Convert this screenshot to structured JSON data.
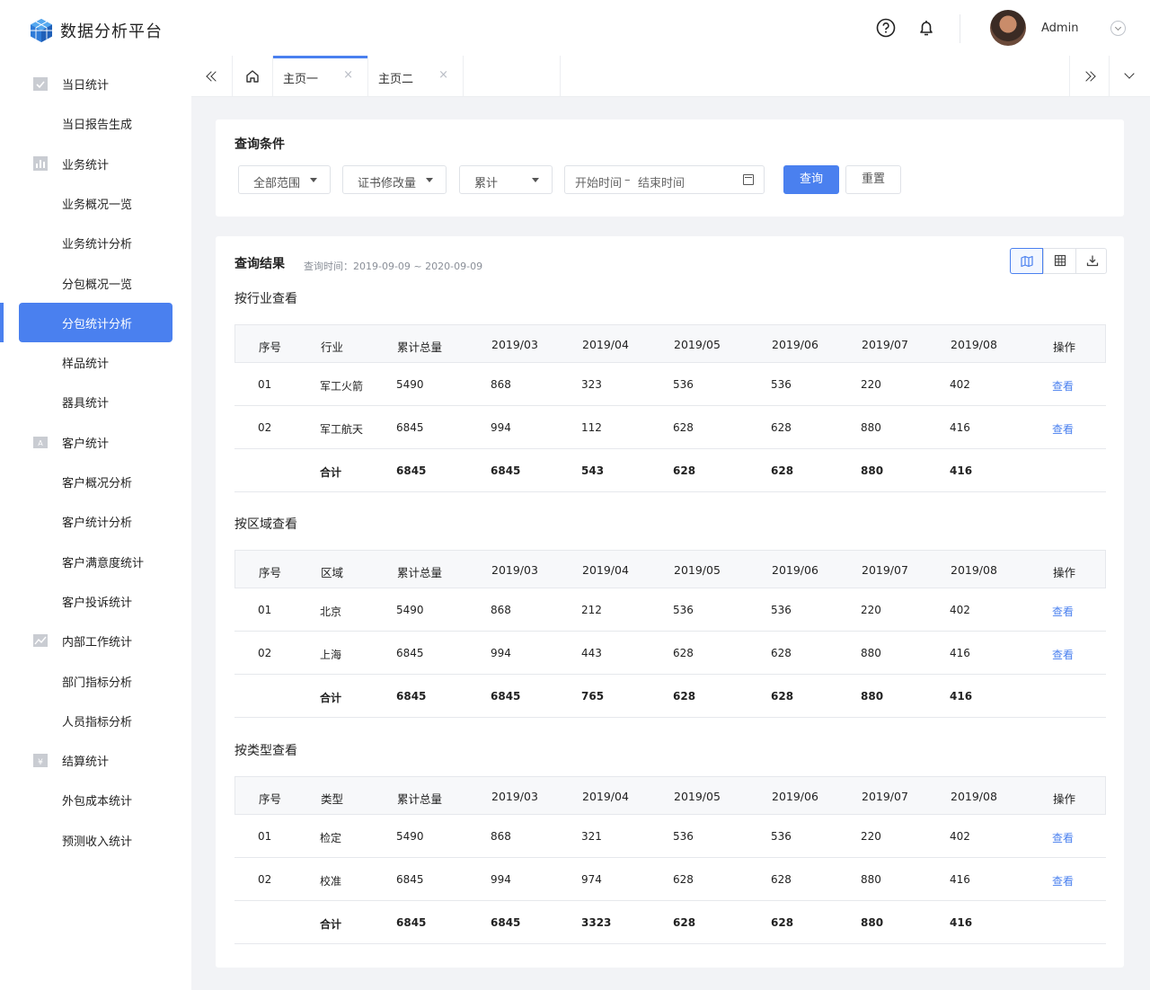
{
  "brand": "数据分析平台",
  "user": {
    "name": "Admin"
  },
  "colors": {
    "accent": "#4a80ef",
    "content_bg": "#f2f3f6"
  },
  "sidebar": {
    "items": [
      {
        "label": "当日统计",
        "icon": "calendar-check-icon",
        "level": 1
      },
      {
        "label": "当日报告生成",
        "level": 2
      },
      {
        "label": "业务统计",
        "icon": "bar-chart-icon",
        "level": 1
      },
      {
        "label": "业务概况一览",
        "level": 2
      },
      {
        "label": "业务统计分析",
        "level": 2
      },
      {
        "label": "分包概况一览",
        "level": 2
      },
      {
        "label": "分包统计分析",
        "level": 2,
        "active": true
      },
      {
        "label": "样品统计",
        "level": 2
      },
      {
        "label": "器具统计",
        "level": 2
      },
      {
        "label": "客户统计",
        "icon": "customer-card-icon",
        "level": 1
      },
      {
        "label": "客户概况分析",
        "level": 2
      },
      {
        "label": "客户统计分析",
        "level": 2
      },
      {
        "label": "客户满意度统计",
        "level": 2
      },
      {
        "label": "客户投诉统计",
        "level": 2
      },
      {
        "label": "内部工作统计",
        "icon": "trend-chart-icon",
        "level": 1
      },
      {
        "label": "部门指标分析",
        "level": 2
      },
      {
        "label": "人员指标分析",
        "level": 2
      },
      {
        "label": "结算统计",
        "icon": "yen-icon",
        "level": 1
      },
      {
        "label": "外包成本统计",
        "level": 2
      },
      {
        "label": "预测收入统计",
        "level": 2
      }
    ]
  },
  "tabs": [
    {
      "label": "主页一",
      "close": "×",
      "active": true
    },
    {
      "label": "主页二",
      "close": "×"
    }
  ],
  "query": {
    "title": "查询条件",
    "scope": "全部范围",
    "type": "证书修改量",
    "mode": "累计",
    "date_start": "开始时间",
    "date_sep": "–",
    "date_end": "结束时间",
    "search": "查询",
    "reset": "重置"
  },
  "results": {
    "title": "查询结果",
    "time": "查询时间：2019-09-09 ~ 2020-09-09",
    "headers_common": [
      "序号",
      "",
      "累计总量",
      "2019/03",
      "2019/04",
      "2019/05",
      "2019/06",
      "2019/07",
      "2019/08",
      "操作"
    ],
    "sections": [
      {
        "title": "按行业查看",
        "dim": "行业",
        "rows": [
          [
            "01",
            "军工火箭",
            "5490",
            "868",
            "323",
            "536",
            "536",
            "220",
            "402",
            "查看"
          ],
          [
            "02",
            "军工航天",
            "6845",
            "994",
            "112",
            "628",
            "628",
            "880",
            "416",
            "查看"
          ]
        ],
        "total": [
          "",
          "合计",
          "6845",
          "6845",
          "543",
          "628",
          "628",
          "880",
          "416",
          ""
        ]
      },
      {
        "title": "按区域查看",
        "dim": "区域",
        "rows": [
          [
            "01",
            "北京",
            "5490",
            "868",
            "212",
            "536",
            "536",
            "220",
            "402",
            "查看"
          ],
          [
            "02",
            "上海",
            "6845",
            "994",
            "443",
            "628",
            "628",
            "880",
            "416",
            "查看"
          ]
        ],
        "total": [
          "",
          "合计",
          "6845",
          "6845",
          "765",
          "628",
          "628",
          "880",
          "416",
          ""
        ]
      },
      {
        "title": "按类型查看",
        "dim": "类型",
        "rows": [
          [
            "01",
            "检定",
            "5490",
            "868",
            "321",
            "536",
            "536",
            "220",
            "402",
            "查看"
          ],
          [
            "02",
            "校准",
            "6845",
            "994",
            "974",
            "628",
            "628",
            "880",
            "416",
            "查看"
          ]
        ],
        "total": [
          "",
          "合计",
          "6845",
          "6845",
          "3323",
          "628",
          "628",
          "880",
          "416",
          ""
        ]
      }
    ]
  }
}
